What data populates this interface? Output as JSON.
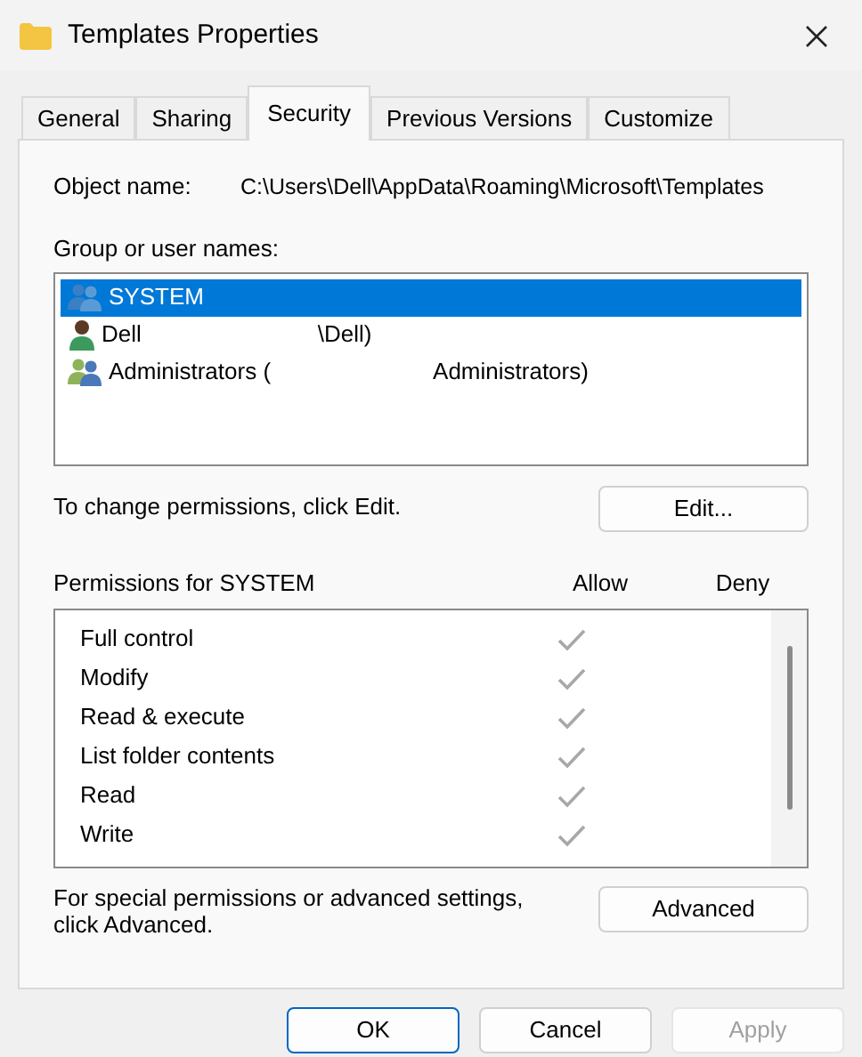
{
  "window": {
    "title": "Templates Properties"
  },
  "tabs": [
    {
      "label": "General",
      "selected": false
    },
    {
      "label": "Sharing",
      "selected": false
    },
    {
      "label": "Security",
      "selected": true
    },
    {
      "label": "Previous Versions",
      "selected": false
    },
    {
      "label": "Customize",
      "selected": false
    }
  ],
  "object_name": {
    "label": "Object name:",
    "value": "C:\\Users\\Dell\\AppData\\Roaming\\Microsoft\\Templates"
  },
  "group_list": {
    "label": "Group or user names:",
    "items": [
      {
        "kind": "group",
        "name": "SYSTEM",
        "selected": true
      },
      {
        "kind": "user",
        "name": "Dell",
        "suffix": "\\Dell)",
        "selected": false
      },
      {
        "kind": "admins",
        "name": "Administrators (",
        "suffix": "Administrators)",
        "selected": false
      }
    ]
  },
  "edit_hint": "To change permissions, click Edit.",
  "edit_button": "Edit...",
  "permissions": {
    "label": "Permissions for SYSTEM",
    "allow_header": "Allow",
    "deny_header": "Deny",
    "rows": [
      {
        "label": "Full control",
        "allow": true,
        "deny": false
      },
      {
        "label": "Modify",
        "allow": true,
        "deny": false
      },
      {
        "label": "Read & execute",
        "allow": true,
        "deny": false
      },
      {
        "label": "List folder contents",
        "allow": true,
        "deny": false
      },
      {
        "label": "Read",
        "allow": true,
        "deny": false
      },
      {
        "label": "Write",
        "allow": true,
        "deny": false
      }
    ]
  },
  "advanced_hint": "For special permissions or advanced settings, click Advanced.",
  "advanced_button": "Advanced",
  "buttons": [
    {
      "label": "OK",
      "kind": "default",
      "disabled": false
    },
    {
      "label": "Cancel",
      "kind": "normal",
      "disabled": false
    },
    {
      "label": "Apply",
      "kind": "normal",
      "disabled": true
    }
  ]
}
